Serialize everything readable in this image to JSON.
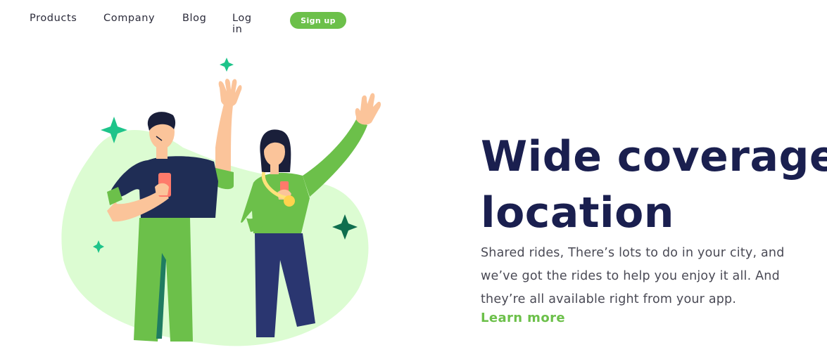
{
  "nav": {
    "items": [
      "Products",
      "Company",
      "Blog",
      "Log in"
    ],
    "signup_label": "Sign up"
  },
  "hero": {
    "title_line1": "Wide coverage",
    "title_line2": "location",
    "description": "Shared rides, There’s lots to do in your city, and we’ve got the rides to help you enjoy it all. And they’re all available right from your app.",
    "link_label": "Learn more"
  },
  "colors": {
    "accent": "#6cc04a",
    "title": "#1a1f4f",
    "blob": "#dcfcd2",
    "sparkle": "#1ec48a"
  },
  "illustration": {
    "icon": "two-people-waving-illustration"
  }
}
